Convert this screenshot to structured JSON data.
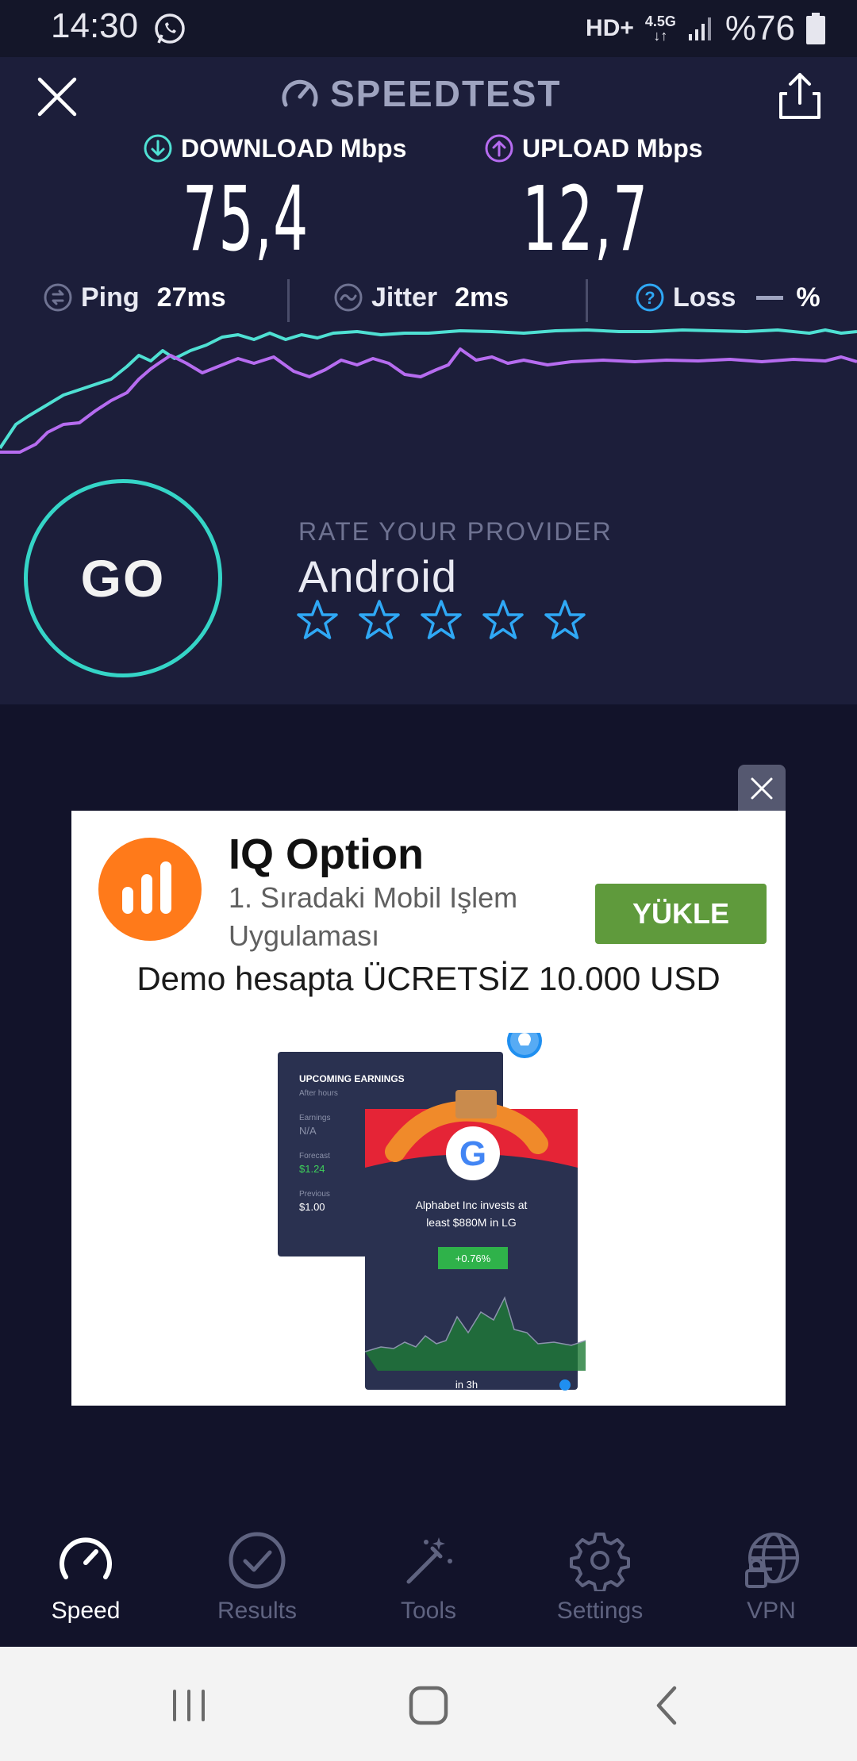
{
  "status_bar": {
    "time": "14:30",
    "network": "HD+",
    "network_type": "4.5G",
    "battery": "%76"
  },
  "header": {
    "logo_text": "SPEEDTEST",
    "download_label": "DOWNLOAD Mbps",
    "upload_label": "UPLOAD Mbps",
    "download_value": "75,4",
    "upload_value": "12,7"
  },
  "stats": {
    "ping_label": "Ping",
    "ping_value": "27ms",
    "jitter_label": "Jitter",
    "jitter_value": "2ms",
    "loss_label": "Loss",
    "loss_value": "%"
  },
  "colors": {
    "download": "#4fe0d3",
    "upload": "#b66cf0",
    "go_ring": "#35d5c7",
    "star": "#2fa8f5"
  },
  "go_button": {
    "label": "GO"
  },
  "rating": {
    "title": "RATE YOUR PROVIDER",
    "provider": "Android",
    "stars_total": 5,
    "stars_filled": 0
  },
  "ad": {
    "title": "IQ Option",
    "subtitle": "1. Sıradaki Mobil Işlem Uygulaması",
    "install_button": "YÜKLE",
    "headline": "Demo hesapta ÜCRETSİZ 10.000 USD",
    "card1": {
      "title": "UPCOMING EARNINGS",
      "subtitle": "After hours",
      "earnings_label": "Earnings",
      "earnings_value": "N/A",
      "forecast_label": "Forecast",
      "forecast_value": "$1.24",
      "previous_label": "Previous",
      "previous_value": "$1.00"
    },
    "card2": {
      "text_line1": "Alphabet Inc invests at",
      "text_line2": "least $880M in LG",
      "change": "+0.76%",
      "time": "in 3h"
    }
  },
  "bottom_nav": {
    "items": [
      {
        "label": "Speed",
        "icon": "speedometer-icon",
        "active": true
      },
      {
        "label": "Results",
        "icon": "check-circle-icon",
        "active": false
      },
      {
        "label": "Tools",
        "icon": "magic-wand-icon",
        "active": false
      },
      {
        "label": "Settings",
        "icon": "gear-icon",
        "active": false
      },
      {
        "label": "VPN",
        "icon": "globe-lock-icon",
        "active": false
      }
    ]
  }
}
